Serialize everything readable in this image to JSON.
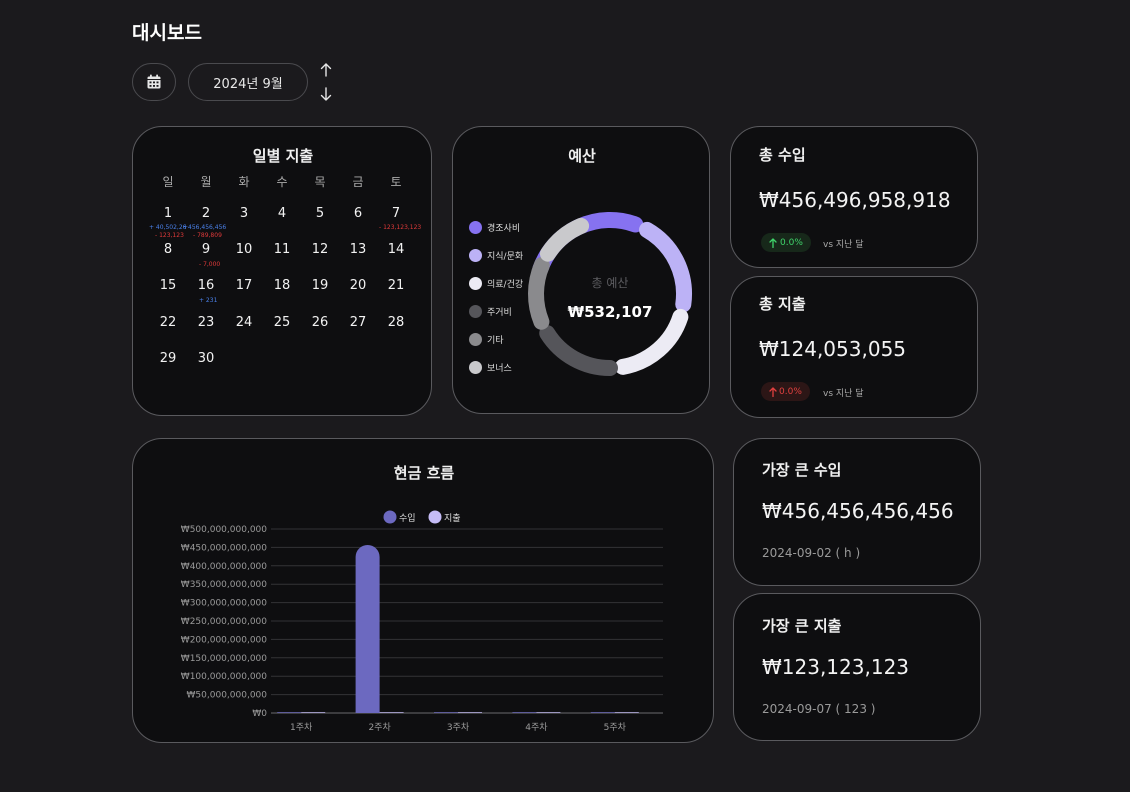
{
  "page": {
    "title": "대시보드"
  },
  "toolbar": {
    "month": "2024년 9월"
  },
  "calendar": {
    "title": "일별 지출",
    "weekdays": [
      "일",
      "월",
      "화",
      "수",
      "목",
      "금",
      "토"
    ],
    "days": [
      "1",
      "2",
      "3",
      "4",
      "5",
      "6",
      "7",
      "8",
      "9",
      "10",
      "11",
      "12",
      "13",
      "14",
      "15",
      "16",
      "17",
      "18",
      "19",
      "20",
      "21",
      "22",
      "23",
      "24",
      "25",
      "26",
      "27",
      "28",
      "29",
      "30"
    ],
    "tx": {
      "d1_in": "+ 40,502,26",
      "d1_out": "- 123,123",
      "d2_in": "+456,456,456",
      "d2_out": "- 789,809",
      "d7_out": "- 123,123,123",
      "d9_out": "- 7,000",
      "d16_in": "+ 231"
    }
  },
  "budget": {
    "title": "예산",
    "center_label": "총 예산",
    "center_value": "₩532,107",
    "legend": [
      {
        "label": "경조사비",
        "color": "#8672f0"
      },
      {
        "label": "지식/문화",
        "color": "#bcb2f6"
      },
      {
        "label": "의료/건강",
        "color": "#ecebf4"
      },
      {
        "label": "주거비",
        "color": "#55555a"
      },
      {
        "label": "기타",
        "color": "#8a8a8d"
      },
      {
        "label": "보너스",
        "color": "#c9c9cc"
      }
    ]
  },
  "income": {
    "title": "총 수입",
    "value": "₩456,496,958,918",
    "change": "0.0%",
    "vs": "vs 지난 달"
  },
  "expense": {
    "title": "총 지출",
    "value": "₩124,053,055",
    "change": "0.0%",
    "vs": "vs 지난 달"
  },
  "max_income": {
    "title": "가장 큰 수입",
    "value": "₩456,456,456,456",
    "date": "2024-09-02 ( h )"
  },
  "max_expense": {
    "title": "가장 큰 지출",
    "value": "₩123,123,123",
    "date": "2024-09-07 ( 123 )"
  },
  "cashflow": {
    "title": "현금 흐름",
    "colors": {
      "income": "#6c69c0",
      "expense": "#c5bcf6"
    }
  },
  "chart_data": {
    "type": "bar",
    "categories": [
      "1주차",
      "2주차",
      "3주차",
      "4주차",
      "5주차"
    ],
    "series": [
      {
        "name": "수입",
        "values": [
          40502260,
          456456456456,
          0,
          0,
          0
        ]
      },
      {
        "name": "지출",
        "values": [
          912246,
          123123123,
          7000,
          0,
          0
        ]
      }
    ],
    "ylim": [
      0,
      500000000000
    ],
    "yticks": [
      "₩0",
      "₩50,000,000,000",
      "₩100,000,000,000",
      "₩150,000,000,000",
      "₩200,000,000,000",
      "₩250,000,000,000",
      "₩300,000,000,000",
      "₩350,000,000,000",
      "₩400,000,000,000",
      "₩450,000,000,000",
      "₩500,000,000,000"
    ],
    "grid": true,
    "legend_position": "top-center"
  }
}
